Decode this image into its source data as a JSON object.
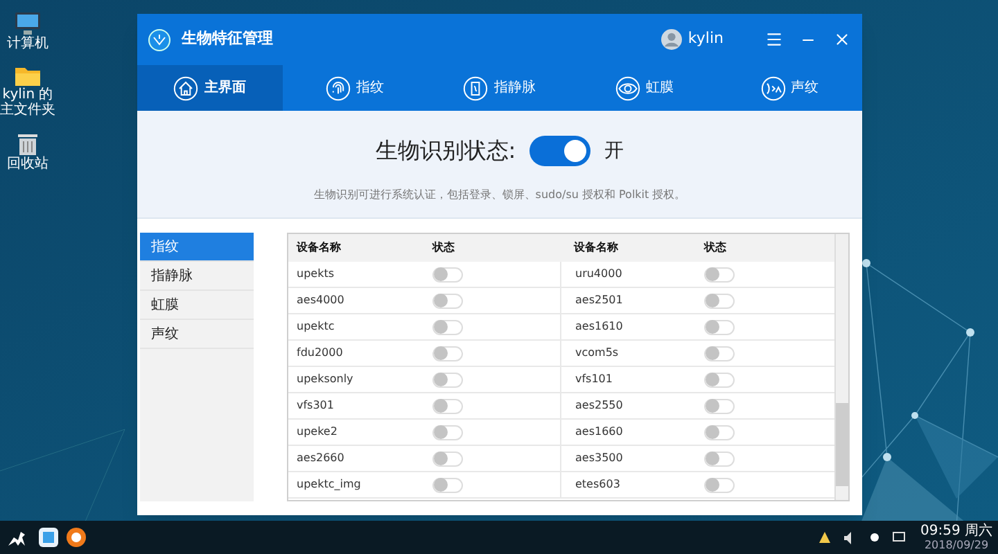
{
  "desktop_icons": [
    {
      "kind": "computer",
      "label": "计算机"
    },
    {
      "kind": "folder",
      "label": "kylin 的主文件夹"
    },
    {
      "kind": "trash",
      "label": "回收站"
    }
  ],
  "window": {
    "title": "生物特征管理",
    "user": "kylin",
    "tabs": [
      {
        "kind": "home",
        "label": "主界面",
        "selected": true
      },
      {
        "kind": "fingerprint",
        "label": "指纹",
        "selected": false
      },
      {
        "kind": "vein",
        "label": "指静脉",
        "selected": false
      },
      {
        "kind": "iris",
        "label": "虹膜",
        "selected": false
      },
      {
        "kind": "voice",
        "label": "声纹",
        "selected": false
      }
    ],
    "status": {
      "label": "生物识别状态:",
      "on": true,
      "state_text": "开"
    },
    "description": "生物识别可进行系统认证，包括登录、锁屏、sudo/su 授权和 Polkit 授权。",
    "sidebar": [
      {
        "label": "指纹",
        "selected": true
      },
      {
        "label": "指静脉",
        "selected": false
      },
      {
        "label": "虹膜",
        "selected": false
      },
      {
        "label": "声纹",
        "selected": false
      }
    ],
    "table": {
      "columns": [
        "设备名称",
        "状态",
        "设备名称",
        "状态"
      ],
      "rows": [
        [
          {
            "name": "upekts",
            "on": false
          },
          {
            "name": "uru4000",
            "on": false
          }
        ],
        [
          {
            "name": "aes4000",
            "on": false
          },
          {
            "name": "aes2501",
            "on": false
          }
        ],
        [
          {
            "name": "upektc",
            "on": false
          },
          {
            "name": "aes1610",
            "on": false
          }
        ],
        [
          {
            "name": "fdu2000",
            "on": false
          },
          {
            "name": "vcom5s",
            "on": false
          }
        ],
        [
          {
            "name": "upeksonly",
            "on": false
          },
          {
            "name": "vfs101",
            "on": false
          }
        ],
        [
          {
            "name": "vfs301",
            "on": false
          },
          {
            "name": "aes2550",
            "on": false
          }
        ],
        [
          {
            "name": "upeke2",
            "on": false
          },
          {
            "name": "aes1660",
            "on": false
          }
        ],
        [
          {
            "name": "aes2660",
            "on": false
          },
          {
            "name": "aes3500",
            "on": false
          }
        ],
        [
          {
            "name": "upektc_img",
            "on": false
          },
          {
            "name": "etes603",
            "on": false
          }
        ]
      ]
    }
  },
  "taskbar": {
    "time": "09:59 周六",
    "date": "2018/09/29"
  }
}
